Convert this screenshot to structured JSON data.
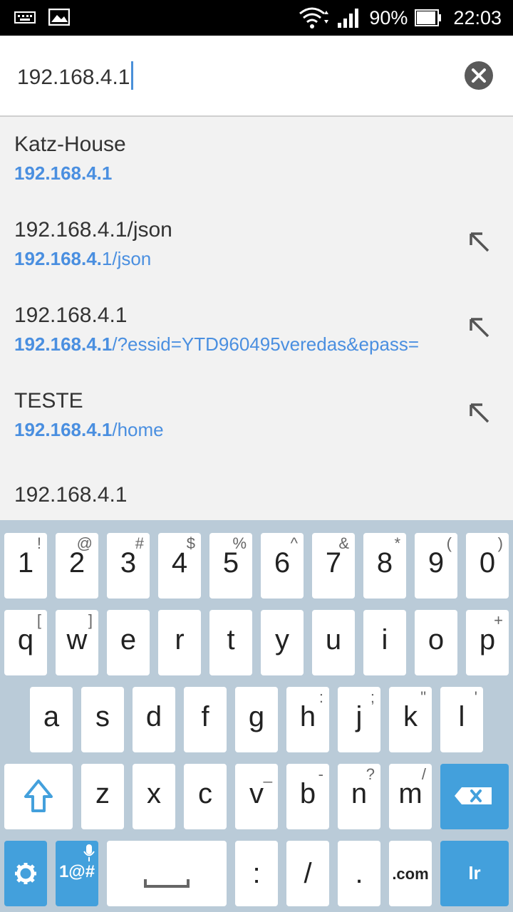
{
  "status_bar": {
    "battery_percent": "90%",
    "time": "22:03",
    "icons": [
      "keyboard-icon",
      "image-icon",
      "wifi-icon",
      "signal-icon",
      "battery-icon"
    ]
  },
  "url_bar": {
    "value": "192.168.4.1"
  },
  "suggestions": [
    {
      "title": "Katz-House",
      "url_bold": "192.168.4.1",
      "url_rest": "",
      "has_arrow": false
    },
    {
      "title": "192.168.4.1/json",
      "url_bold": "192.168.4.",
      "url_rest": "1/json",
      "has_arrow": true
    },
    {
      "title": "192.168.4.1",
      "url_bold": "192.168.4.1",
      "url_rest": "/?essid=YTD960495veredas&epass=",
      "has_arrow": true
    },
    {
      "title": "TESTE",
      "url_bold": "192.168.4.1",
      "url_rest": "/home",
      "has_arrow": true
    },
    {
      "title": "192.168.4.1",
      "url_bold": "",
      "url_rest": "",
      "has_arrow": false
    }
  ],
  "keyboard": {
    "row1": [
      {
        "main": "1",
        "sub": "!"
      },
      {
        "main": "2",
        "sub": "@"
      },
      {
        "main": "3",
        "sub": "#"
      },
      {
        "main": "4",
        "sub": "$"
      },
      {
        "main": "5",
        "sub": "%"
      },
      {
        "main": "6",
        "sub": "^"
      },
      {
        "main": "7",
        "sub": "&"
      },
      {
        "main": "8",
        "sub": "*"
      },
      {
        "main": "9",
        "sub": "("
      },
      {
        "main": "0",
        "sub": ")"
      }
    ],
    "row2": [
      {
        "main": "q",
        "sub": "["
      },
      {
        "main": "w",
        "sub": "]"
      },
      {
        "main": "e",
        "sub": ""
      },
      {
        "main": "r",
        "sub": ""
      },
      {
        "main": "t",
        "sub": ""
      },
      {
        "main": "y",
        "sub": ""
      },
      {
        "main": "u",
        "sub": ""
      },
      {
        "main": "i",
        "sub": ""
      },
      {
        "main": "o",
        "sub": ""
      },
      {
        "main": "p",
        "sub": "+"
      }
    ],
    "row3": [
      {
        "main": "a",
        "sub": ""
      },
      {
        "main": "s",
        "sub": ""
      },
      {
        "main": "d",
        "sub": ""
      },
      {
        "main": "f",
        "sub": ""
      },
      {
        "main": "g",
        "sub": ""
      },
      {
        "main": "h",
        "sub": ":"
      },
      {
        "main": "j",
        "sub": ";"
      },
      {
        "main": "k",
        "sub": "\""
      },
      {
        "main": "l",
        "sub": "'"
      }
    ],
    "row4": [
      {
        "main": "z",
        "sub": ""
      },
      {
        "main": "x",
        "sub": ""
      },
      {
        "main": "c",
        "sub": ""
      },
      {
        "main": "v",
        "sub": "_"
      },
      {
        "main": "b",
        "sub": "-"
      },
      {
        "main": "n",
        "sub": "?"
      },
      {
        "main": "m",
        "sub": "/"
      }
    ],
    "symbols_label": "1@#",
    "colon_label": ":",
    "slash_label": "/",
    "period_label": ".",
    "com_label": ".com",
    "go_label": "Ir"
  }
}
